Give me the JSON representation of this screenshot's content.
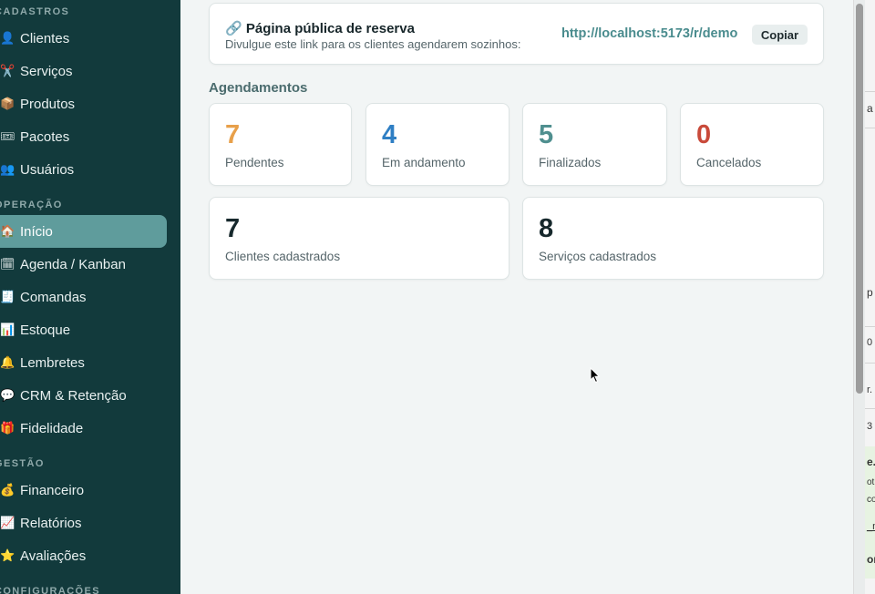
{
  "sidebar": {
    "sections": [
      {
        "title": "CADASTROS",
        "items": [
          {
            "icon": "👤",
            "label": "Clientes"
          },
          {
            "icon": "✂️",
            "label": "Serviços"
          },
          {
            "icon": "📦",
            "label": "Produtos"
          },
          {
            "icon": "🎟",
            "label": "Pacotes"
          },
          {
            "icon": "👥",
            "label": "Usuários"
          }
        ]
      },
      {
        "title": "OPERAÇÃO",
        "items": [
          {
            "icon": "🏠",
            "label": "Início",
            "active": true
          },
          {
            "icon": "🗓",
            "label": "Agenda / Kanban"
          },
          {
            "icon": "🧾",
            "label": "Comandas"
          },
          {
            "icon": "📊",
            "label": "Estoque"
          },
          {
            "icon": "🔔",
            "label": "Lembretes"
          },
          {
            "icon": "💬",
            "label": "CRM & Retenção"
          },
          {
            "icon": "🎁",
            "label": "Fidelidade"
          }
        ]
      },
      {
        "title": "GESTÃO",
        "items": [
          {
            "icon": "💰",
            "label": "Financeiro"
          },
          {
            "icon": "📈",
            "label": "Relatórios"
          },
          {
            "icon": "⭐",
            "label": "Avaliações"
          }
        ]
      },
      {
        "title": "CONFIGURAÇÕES",
        "items": []
      }
    ]
  },
  "public_page": {
    "icon": "🔗",
    "title": "Página pública de reserva",
    "description": "Divulgue este link para os clientes agendarem sozinhos:",
    "link": "http://localhost:5173/r/demo",
    "copy_label": "Copiar"
  },
  "appointments": {
    "heading": "Agendamentos",
    "stats": [
      {
        "value": "7",
        "label": "Pendentes",
        "color": "#e8a04a"
      },
      {
        "value": "4",
        "label": "Em andamento",
        "color": "#2f7fc4"
      },
      {
        "value": "5",
        "label": "Finalizados",
        "color": "#4f8f8f"
      },
      {
        "value": "0",
        "label": "Cancelados",
        "color": "#c94a3a"
      }
    ]
  },
  "totals": [
    {
      "value": "7",
      "label": "Clientes cadastrados",
      "color": "#16282c"
    },
    {
      "value": "8",
      "label": "Serviços cadastrados",
      "color": "#16282c"
    }
  ],
  "right_panel_fragments": [
    "a",
    "p",
    "0",
    "r.",
    "3",
    "e.(",
    "ot",
    "co",
    "_n",
    "or"
  ]
}
